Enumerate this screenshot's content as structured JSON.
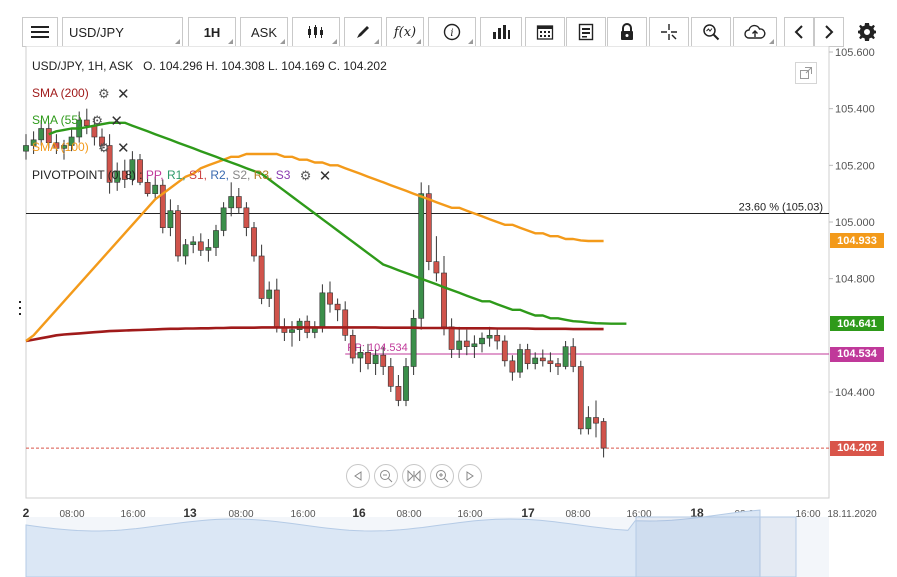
{
  "toolbar": {
    "symbol": "USD/JPY",
    "timeframe": "1H",
    "price_type": "ASK",
    "formula_label": "f(x)"
  },
  "header": {
    "title_prefix": "USD/JPY, 1H, ASK",
    "open_label": "O. 104.296",
    "high_label": "H. 104.308",
    "low_label": "L. 104.169",
    "close_label": "C. 104.202"
  },
  "indicators": [
    {
      "label": "SMA (200)",
      "color": "#a01a1a"
    },
    {
      "label": "SMA (55)",
      "color": "#2e9a1a"
    },
    {
      "label": "SMA (100)",
      "color": "#f39a1a"
    }
  ],
  "pivot": {
    "prefix": "PIVOTPOINT (0, 8) :",
    "items": [
      {
        "label": "PP,",
        "color": "#c0399a"
      },
      {
        "label": "R1,",
        "color": "#2e9a6a"
      },
      {
        "label": "S1,",
        "color": "#c44"
      },
      {
        "label": "R2,",
        "color": "#3a6ab0"
      },
      {
        "label": "S2,",
        "color": "#888"
      },
      {
        "label": "R3,",
        "color": "#b07a20"
      },
      {
        "label": "S3",
        "color": "#8a3ab0"
      }
    ],
    "pp_label": "PP: 104.534"
  },
  "fib_label": "23.60 % (105.03)",
  "price_tags": {
    "sma100": "104.933",
    "sma55": "104.641",
    "pp": "104.534",
    "last": "104.202"
  },
  "colors": {
    "up": "#3b8f4a",
    "down": "#d0534b",
    "sma200": "#a01a1a",
    "sma55": "#2e9a1a",
    "sma100": "#f39a1a",
    "pp": "#c0399a",
    "last": "#d9554a"
  },
  "chart_data": {
    "type": "candlestick",
    "symbol": "USD/JPY",
    "timeframe": "1H",
    "ylim": [
      104.03,
      105.62
    ],
    "y_ticks": [
      "105.600",
      "105.400",
      "105.200",
      "105.000",
      "104.800",
      "104.400"
    ],
    "x_ticks": [
      {
        "label": "2",
        "bold": true
      },
      {
        "label": "08:00",
        "bold": false
      },
      {
        "label": "16:00",
        "bold": false
      },
      {
        "label": "13",
        "bold": true
      },
      {
        "label": "08:00",
        "bold": false
      },
      {
        "label": "16:00",
        "bold": false
      },
      {
        "label": "16",
        "bold": true
      },
      {
        "label": "08:00",
        "bold": false
      },
      {
        "label": "16:00",
        "bold": false
      },
      {
        "label": "17",
        "bold": true
      },
      {
        "label": "08:00",
        "bold": false
      },
      {
        "label": "16:00",
        "bold": false
      },
      {
        "label": "18",
        "bold": true
      },
      {
        "label": "08:00",
        "bold": false
      },
      {
        "label": "16:00",
        "bold": false
      },
      {
        "label": "18.11.2020",
        "bold": false
      }
    ],
    "candles": [
      [
        105.25,
        105.31,
        105.22,
        105.27
      ],
      [
        105.27,
        105.32,
        105.24,
        105.29
      ],
      [
        105.29,
        105.36,
        105.27,
        105.33
      ],
      [
        105.33,
        105.35,
        105.26,
        105.28
      ],
      [
        105.28,
        105.31,
        105.24,
        105.26
      ],
      [
        105.26,
        105.29,
        105.22,
        105.27
      ],
      [
        105.27,
        105.33,
        105.25,
        105.3
      ],
      [
        105.3,
        105.39,
        105.28,
        105.36
      ],
      [
        105.36,
        105.4,
        105.31,
        105.34
      ],
      [
        105.34,
        105.37,
        105.27,
        105.3
      ],
      [
        105.3,
        105.33,
        105.25,
        105.27
      ],
      [
        105.27,
        105.31,
        105.1,
        105.14
      ],
      [
        105.14,
        105.21,
        105.11,
        105.18
      ],
      [
        105.18,
        105.22,
        105.12,
        105.15
      ],
      [
        105.15,
        105.25,
        105.13,
        105.22
      ],
      [
        105.22,
        105.24,
        105.13,
        105.14
      ],
      [
        105.14,
        105.17,
        105.09,
        105.1
      ],
      [
        105.1,
        105.16,
        105.08,
        105.13
      ],
      [
        105.13,
        105.15,
        104.96,
        104.98
      ],
      [
        104.98,
        105.08,
        104.95,
        105.04
      ],
      [
        105.04,
        105.06,
        104.86,
        104.88
      ],
      [
        104.88,
        104.94,
        104.85,
        104.92
      ],
      [
        104.92,
        104.95,
        104.89,
        104.93
      ],
      [
        104.93,
        104.96,
        104.88,
        104.9
      ],
      [
        104.9,
        104.94,
        104.86,
        104.91
      ],
      [
        104.91,
        104.99,
        104.88,
        104.97
      ],
      [
        104.97,
        105.07,
        104.95,
        105.05
      ],
      [
        105.05,
        105.14,
        105.02,
        105.09
      ],
      [
        105.09,
        105.12,
        105.03,
        105.05
      ],
      [
        105.05,
        105.07,
        104.95,
        104.98
      ],
      [
        104.98,
        105.0,
        104.86,
        104.88
      ],
      [
        104.88,
        104.92,
        104.71,
        104.73
      ],
      [
        104.73,
        104.79,
        104.7,
        104.76
      ],
      [
        104.76,
        104.8,
        104.61,
        104.63
      ],
      [
        104.63,
        104.66,
        104.58,
        104.61
      ],
      [
        104.61,
        104.65,
        104.56,
        104.62
      ],
      [
        104.62,
        104.66,
        104.58,
        104.65
      ],
      [
        104.65,
        104.67,
        104.59,
        104.61
      ],
      [
        104.61,
        104.65,
        104.59,
        104.63
      ],
      [
        104.63,
        104.78,
        104.61,
        104.75
      ],
      [
        104.75,
        104.79,
        104.68,
        104.71
      ],
      [
        104.71,
        104.73,
        104.65,
        104.69
      ],
      [
        104.69,
        104.72,
        104.58,
        104.6
      ],
      [
        104.6,
        104.62,
        104.5,
        104.52
      ],
      [
        104.52,
        104.56,
        104.47,
        104.54
      ],
      [
        104.54,
        104.57,
        104.48,
        104.5
      ],
      [
        104.5,
        104.55,
        104.46,
        104.53
      ],
      [
        104.53,
        104.56,
        104.46,
        104.49
      ],
      [
        104.49,
        104.52,
        104.4,
        104.42
      ],
      [
        104.42,
        104.46,
        104.35,
        104.37
      ],
      [
        104.37,
        104.52,
        104.35,
        104.49
      ],
      [
        104.49,
        104.69,
        104.46,
        104.66
      ],
      [
        104.66,
        105.14,
        104.62,
        105.1
      ],
      [
        105.1,
        105.13,
        104.83,
        104.86
      ],
      [
        104.86,
        104.95,
        104.79,
        104.82
      ],
      [
        104.82,
        104.88,
        104.6,
        104.63
      ],
      [
        104.63,
        104.66,
        104.52,
        104.55
      ],
      [
        104.55,
        104.63,
        104.52,
        104.58
      ],
      [
        104.58,
        104.62,
        104.53,
        104.56
      ],
      [
        104.56,
        104.6,
        104.52,
        104.57
      ],
      [
        104.57,
        104.61,
        104.54,
        104.59
      ],
      [
        104.59,
        104.63,
        104.56,
        104.6
      ],
      [
        104.6,
        104.62,
        104.55,
        104.58
      ],
      [
        104.58,
        104.6,
        104.49,
        104.51
      ],
      [
        104.51,
        104.53,
        104.44,
        104.47
      ],
      [
        104.47,
        104.57,
        104.45,
        104.55
      ],
      [
        104.55,
        104.57,
        104.48,
        104.5
      ],
      [
        104.5,
        104.54,
        104.48,
        104.52
      ],
      [
        104.52,
        104.55,
        104.49,
        104.51
      ],
      [
        104.51,
        104.54,
        104.47,
        104.5
      ],
      [
        104.5,
        104.52,
        104.46,
        104.49
      ],
      [
        104.49,
        104.58,
        104.48,
        104.56
      ],
      [
        104.56,
        104.59,
        104.47,
        104.49
      ],
      [
        104.49,
        104.51,
        104.25,
        104.27
      ],
      [
        104.27,
        104.35,
        104.25,
        104.31
      ],
      [
        104.31,
        104.37,
        104.24,
        104.29
      ],
      [
        104.296,
        104.308,
        104.169,
        104.202
      ]
    ],
    "sma200": [
      104.58,
      104.585,
      104.59,
      104.595,
      104.6,
      104.603,
      104.605,
      104.607,
      104.609,
      104.611,
      104.613,
      104.615,
      104.616,
      104.617,
      104.618,
      104.619,
      104.62,
      104.621,
      104.622,
      104.623,
      104.623,
      104.624,
      104.624,
      104.625,
      104.625,
      104.626,
      104.626,
      104.627,
      104.627,
      104.627,
      104.627,
      104.628,
      104.628,
      104.628,
      104.628,
      104.628,
      104.628,
      104.628,
      104.628,
      104.628,
      104.628,
      104.628,
      104.628,
      104.628,
      104.628,
      104.628,
      104.628,
      104.627,
      104.627,
      104.627,
      104.627,
      104.627,
      104.626,
      104.626,
      104.626,
      104.626,
      104.626,
      104.625,
      104.625,
      104.625,
      104.625,
      104.625,
      104.624,
      104.624,
      104.624,
      104.624,
      104.624,
      104.623,
      104.623,
      104.623,
      104.623,
      104.623,
      104.622,
      104.622,
      104.622,
      104.622,
      104.622
    ],
    "sma100": [
      104.58,
      104.6,
      104.63,
      104.66,
      104.69,
      104.72,
      104.75,
      104.78,
      104.81,
      104.84,
      104.87,
      104.9,
      104.93,
      104.96,
      104.99,
      105.02,
      105.05,
      105.08,
      105.1,
      105.12,
      105.14,
      105.16,
      105.17,
      105.19,
      105.2,
      105.21,
      105.22,
      105.23,
      105.23,
      105.24,
      105.24,
      105.24,
      105.24,
      105.24,
      105.23,
      105.23,
      105.22,
      105.22,
      105.21,
      105.21,
      105.2,
      105.2,
      105.19,
      105.18,
      105.17,
      105.16,
      105.15,
      105.14,
      105.13,
      105.12,
      105.11,
      105.1,
      105.09,
      105.08,
      105.07,
      105.06,
      105.05,
      105.05,
      105.04,
      105.03,
      105.02,
      105.01,
      105.0,
      104.99,
      104.99,
      104.98,
      104.97,
      104.96,
      104.96,
      104.95,
      104.95,
      104.94,
      104.94,
      104.935,
      104.933,
      104.933,
      104.933
    ],
    "sma55": [
      105.31,
      105.32,
      105.325,
      105.33,
      105.33,
      105.335,
      105.34,
      105.345,
      105.35,
      105.35,
      105.35,
      105.34,
      105.33,
      105.32,
      105.31,
      105.3,
      105.29,
      105.28,
      105.27,
      105.26,
      105.25,
      105.24,
      105.23,
      105.22,
      105.21,
      105.2,
      105.19,
      105.18,
      105.17,
      105.15,
      105.13,
      105.11,
      105.09,
      105.07,
      105.05,
      105.03,
      105.01,
      104.99,
      104.97,
      104.95,
      104.93,
      104.91,
      104.89,
      104.87,
      104.85,
      104.84,
      104.83,
      104.82,
      104.81,
      104.8,
      104.79,
      104.78,
      104.77,
      104.76,
      104.75,
      104.74,
      104.73,
      104.72,
      104.72,
      104.71,
      104.7,
      104.69,
      104.69,
      104.68,
      104.67,
      104.67,
      104.66,
      104.66,
      104.655,
      104.65,
      104.648,
      104.645,
      104.643,
      104.642,
      104.641,
      104.641,
      104.641
    ],
    "sma200_start_index": 0,
    "sma100_start_index": 0,
    "sma55_start_index": 3,
    "fib_level": 105.03,
    "pivot_pp": 104.534,
    "last_price": 104.202
  }
}
